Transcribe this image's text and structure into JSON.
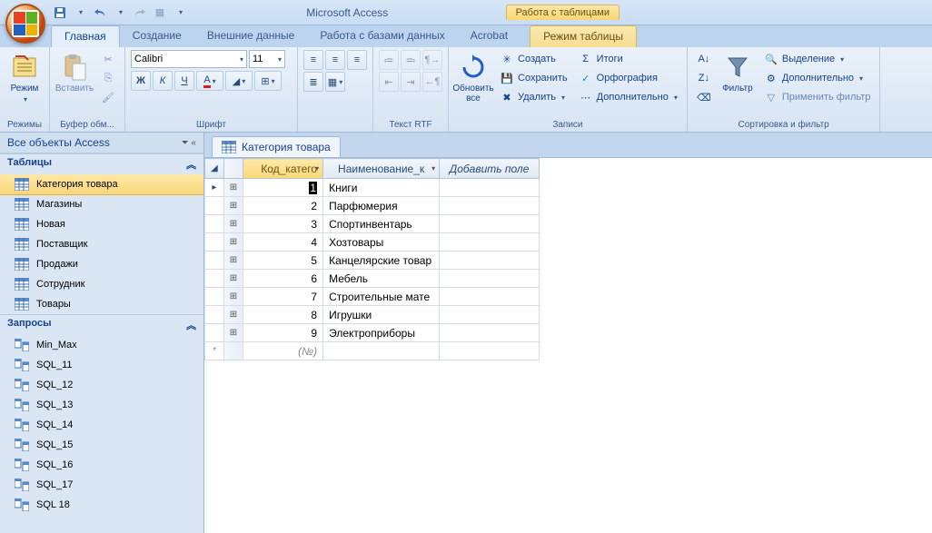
{
  "app_title": "Microsoft Access",
  "context_group": "Работа с таблицами",
  "tabs": {
    "home": "Главная",
    "create": "Создание",
    "external": "Внешние данные",
    "dbtools": "Работа с базами данных",
    "acrobat": "Acrobat",
    "datasheet": "Режим таблицы"
  },
  "ribbon": {
    "modes_group": "Режимы",
    "mode_btn": "Режим",
    "clipboard_group": "Буфер обм...",
    "paste_btn": "Вставить",
    "font_group": "Шрифт",
    "font_name": "Calibri",
    "font_size": "11",
    "rtf_group": "Текст RTF",
    "records_group": "Записи",
    "refresh_btn": "Обновить\nвсе",
    "new_btn": "Создать",
    "save_btn": "Сохранить",
    "delete_btn": "Удалить",
    "totals_btn": "Итоги",
    "spelling_btn": "Орфография",
    "more_btn": "Дополнительно",
    "sortfilter_group": "Сортировка и фильтр",
    "filter_btn": "Фильтр",
    "selection_btn": "Выделение",
    "advanced_btn": "Дополнительно",
    "applyfilter_btn": "Применить фильтр"
  },
  "nav": {
    "header": "Все объекты Access",
    "tables_section": "Таблицы",
    "queries_section": "Запросы",
    "tables": [
      "Категория товара",
      "Магазины",
      "Новая",
      "Поставщик",
      "Продажи",
      "Сотрудник",
      "Товары"
    ],
    "queries": [
      "Min_Max",
      "SQL_11",
      "SQL_12",
      "SQL_13",
      "SQL_14",
      "SQL_15",
      "SQL_16",
      "SQL_17",
      "SQL 18"
    ]
  },
  "document": {
    "tab_title": "Категория товара",
    "col_id": "Код_катего",
    "col_name": "Наименование_к",
    "col_add": "Добавить поле",
    "new_placeholder": "(№)",
    "rows": [
      {
        "id": "1",
        "name": "Книги"
      },
      {
        "id": "2",
        "name": "Парфюмерия"
      },
      {
        "id": "3",
        "name": "Спортинвентарь"
      },
      {
        "id": "4",
        "name": "Хозтовары"
      },
      {
        "id": "5",
        "name": "Канцелярские товар"
      },
      {
        "id": "6",
        "name": "Мебель"
      },
      {
        "id": "7",
        "name": "Строительные мате"
      },
      {
        "id": "8",
        "name": "Игрушки"
      },
      {
        "id": "9",
        "name": "Электроприборы"
      }
    ]
  }
}
